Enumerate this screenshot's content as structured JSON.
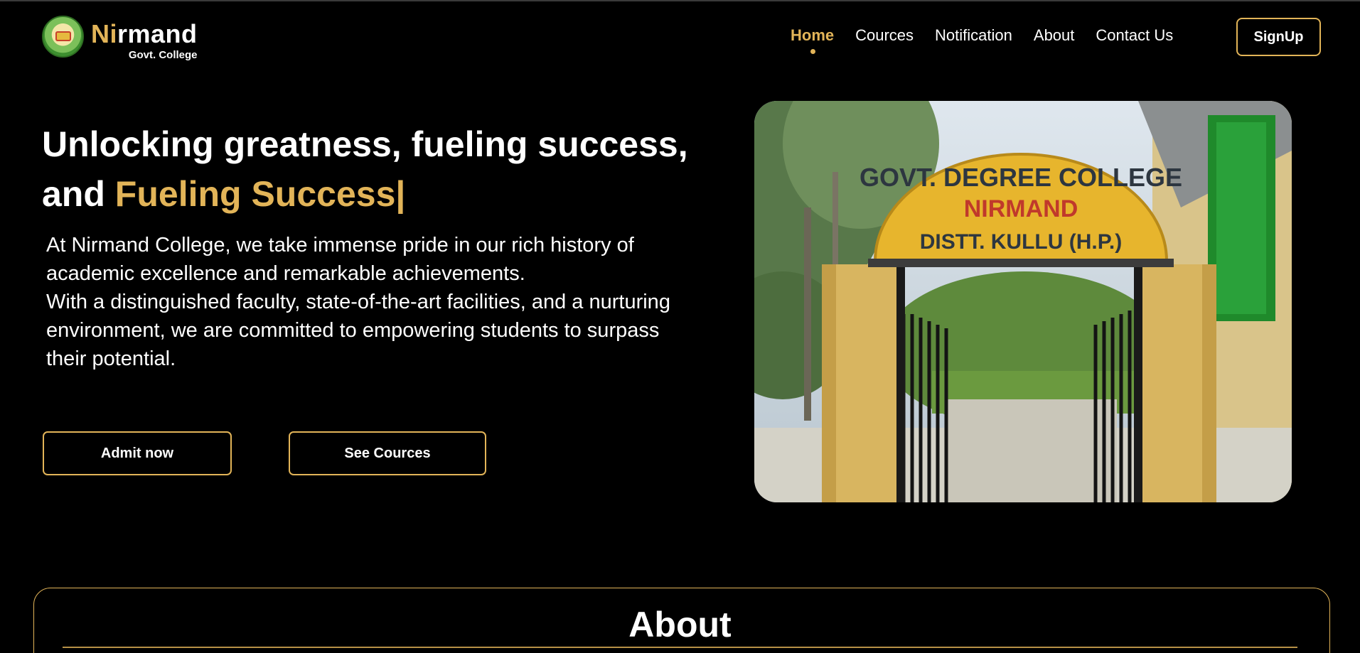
{
  "header": {
    "logo": {
      "name_accent": "Ni",
      "name_rest": "rmand",
      "subtitle": "Govt. College"
    },
    "nav": [
      {
        "label": "Home",
        "active": true
      },
      {
        "label": "Cources",
        "active": false
      },
      {
        "label": "Notification",
        "active": false
      },
      {
        "label": "About",
        "active": false
      },
      {
        "label": "Contact Us",
        "active": false
      }
    ],
    "signup_label": "SignUp"
  },
  "hero": {
    "title_line1": "Unlocking greatness, fueling success,",
    "title_line2_prefix": "and ",
    "title_line2_accent": "Fueling Success|",
    "paragraph1": "At Nirmand College, we take immense pride in our rich history of academic excellence and remarkable achievements.",
    "paragraph2": "With a distinguished faculty, state-of-the-art facilities, and a nurturing environment, we are committed to empowering students to surpass their potential.",
    "admit_label": "Admit now",
    "courses_label": "See Cources"
  },
  "photo": {
    "sign_line1": "GOVT. DEGREE COLLEGE",
    "sign_line2": "NIRMAND",
    "sign_line3": "DISTT. KULLU (H.P.)"
  },
  "about": {
    "title": "About"
  },
  "colors": {
    "accent": "#e2b458",
    "background": "#000000",
    "text": "#ffffff"
  }
}
